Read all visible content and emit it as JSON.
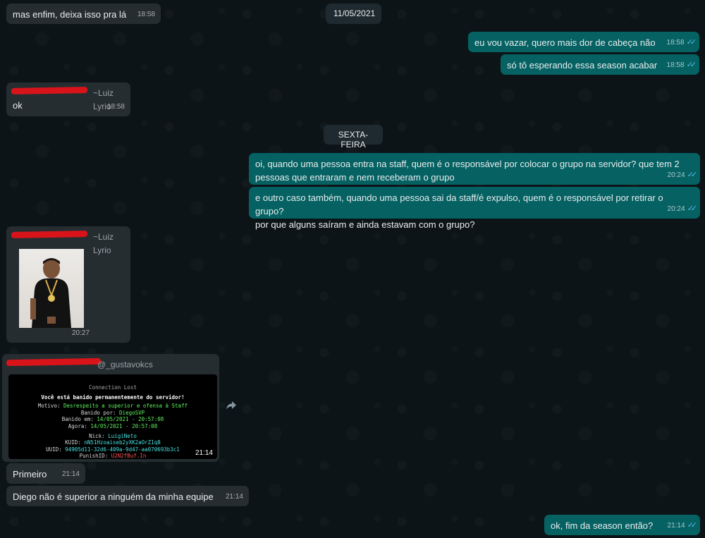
{
  "dates": {
    "first": "11/05/2021",
    "second": "SEXTA-FEIRA"
  },
  "messages": {
    "m1": {
      "text": "mas enfim, deixa isso pra lá",
      "time": "18:58"
    },
    "m2": {
      "text": "eu vou vazar, quero mais dor de cabeça não",
      "time": "18:58",
      "ticks": "✓✓"
    },
    "m3": {
      "text": "só tô esperando essa season acabar",
      "time": "18:58",
      "ticks": "✓✓"
    },
    "m4": {
      "sender_alias": "~Luiz Lyrio",
      "text": "ok",
      "time": "18:58"
    },
    "m5": {
      "line1": "oi, quando uma pessoa entra na staff, quem é o responsável por colocar o grupo na servidor? que tem 2",
      "line2": "pessoas que entraram e nem receberam o grupo",
      "time": "20:24",
      "ticks": "✓✓"
    },
    "m6": {
      "line1": "e outro caso também, quando uma pessoa sai da staff/é expulso, quem é o responsável por retirar o grupo?",
      "line2": "por que alguns saíram e ainda estavam com o grupo?",
      "time": "20:24",
      "ticks": "✓✓"
    },
    "m7": {
      "sender_alias": "~Luiz Lyrio",
      "time": "20:27"
    },
    "m8": {
      "sender_alias": "@_gustavokcs",
      "time": "21:14"
    },
    "m9": {
      "text": "Primeiro",
      "time": "21:14"
    },
    "m10": {
      "text": "Diego não é superior a ninguém da minha equipe",
      "time": "21:14"
    },
    "m11": {
      "text": "ok, fim da season então?",
      "time": "21:14",
      "ticks": "✓✓"
    }
  },
  "game_screenshot": {
    "title": "Connection Lost",
    "banned": "Você está banido permanentemente do servidor!",
    "motivo_label": "Motivo: ",
    "motivo_value": "Desrespeito a superior e ofensa à Staff",
    "banido_por_label": "Banido por: ",
    "banido_por_value": "DiegoSVP",
    "banido_em_label": "Banido em: ",
    "banido_em_value": "14/05/2021 - 20:57:08",
    "agora_label": "Agora: ",
    "agora_value": "14/05/2021 - 20:57:08",
    "nick_label": "Nick: ",
    "nick_value": "LuigiNeto",
    "kuid_label": "KUID: ",
    "kuid_value": "nN51Hzoaiseb2yXK2aOrZ1q8",
    "uuid_label": "UUID: ",
    "uuid_value": "94905d11-32d6-409a-9d47-aa070693b3c1",
    "punish_label": "PunishID: ",
    "punish_value": "U2N2fBuf.In"
  },
  "icons": {
    "forward": "forward-icon",
    "read_receipt": "double-check-icon"
  },
  "colors": {
    "background": "#0d1418",
    "incoming_bubble": "#262d31",
    "outgoing_bubble": "#056162",
    "read_tick": "#53bdeb",
    "redaction": "#d8141a"
  }
}
